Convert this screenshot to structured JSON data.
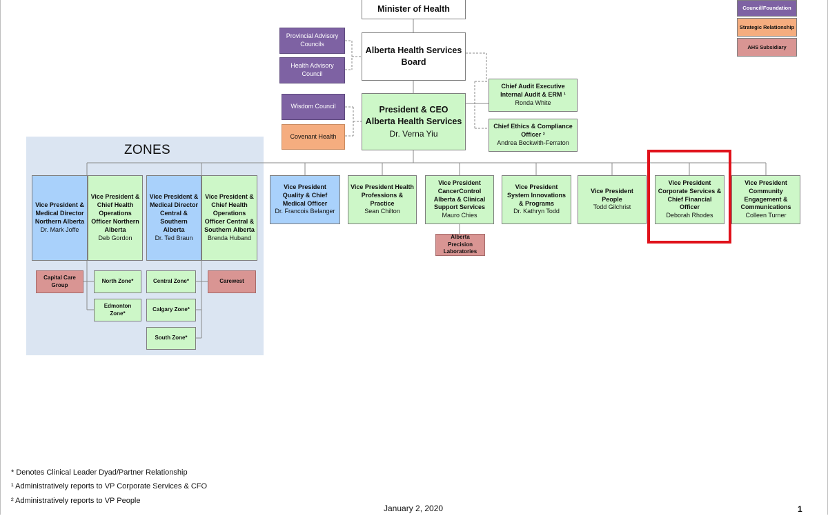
{
  "legend": {
    "council": "Council/Foundation",
    "strategic": "Strategic Relationship",
    "subsidiary": "AHS Subsidiary"
  },
  "top": {
    "minister": "Minister of Health",
    "board": "Alberta Health Services Board",
    "provincial_councils": "Provincial Advisory Councils",
    "health_council": "Health Advisory Council",
    "wisdom_council": "Wisdom Council",
    "covenant": "Covenant Health",
    "ceo_title": "President & CEO Alberta Health Services",
    "ceo_name": "Dr. Verna Yiu",
    "audit_title": "Chief Audit Executive Internal Audit & ERM ¹",
    "audit_name": "Ronda White",
    "ethics_title": "Chief Ethics & Compliance Officer ²",
    "ethics_name": "Andrea Beckwith-Ferraton"
  },
  "zones": {
    "title": "ZONES",
    "vp_med_north_title": "Vice President & Medical Director Northern Alberta",
    "vp_med_north_name": "Dr. Mark Joffe",
    "vp_ops_north_title": "Vice President & Chief Health Operations Officer Northern Alberta",
    "vp_ops_north_name": "Deb Gordon",
    "vp_med_south_title": "Vice President & Medical Director Central & Southern Alberta",
    "vp_med_south_name": "Dr. Ted Braun",
    "vp_ops_south_title": "Vice President & Chief Health Operations Officer Central & Southern Alberta",
    "vp_ops_south_name": "Brenda Huband",
    "capital_care": "Capital Care Group",
    "north_zone": "North Zone*",
    "edmonton_zone": "Edmonton Zone*",
    "central_zone": "Central Zone*",
    "calgary_zone": "Calgary Zone*",
    "south_zone": "South Zone*",
    "carewest": "Carewest"
  },
  "vps": {
    "quality_title": "Vice President Quality & Chief Medical Officer",
    "quality_name": "Dr. Francois Belanger",
    "hpp_title": "Vice President Health Professions & Practice",
    "hpp_name": "Sean Chilton",
    "cancer_title": "Vice President CancerControl Alberta & Clinical Support Services",
    "cancer_name": "Mauro Chies",
    "apl": "Alberta Precision Laboratories",
    "sip_title": "Vice President System Innovations & Programs",
    "sip_name": "Dr. Kathryn Todd",
    "people_title": "Vice President People",
    "people_name": "Todd Gilchrist",
    "cfo_title": "Vice President Corporate Services & Chief Financial Officer",
    "cfo_name": "Deborah Rhodes",
    "community_title": "Vice President Community Engagement & Communications",
    "community_name": "Colleen Turner"
  },
  "footer": {
    "note1": "* Denotes Clinical Leader Dyad/Partner Relationship",
    "note2": "¹ Administratively reports to VP Corporate Services & CFO",
    "note3": "² Administratively reports to VP People",
    "date": "January 2, 2020",
    "page": "1"
  }
}
